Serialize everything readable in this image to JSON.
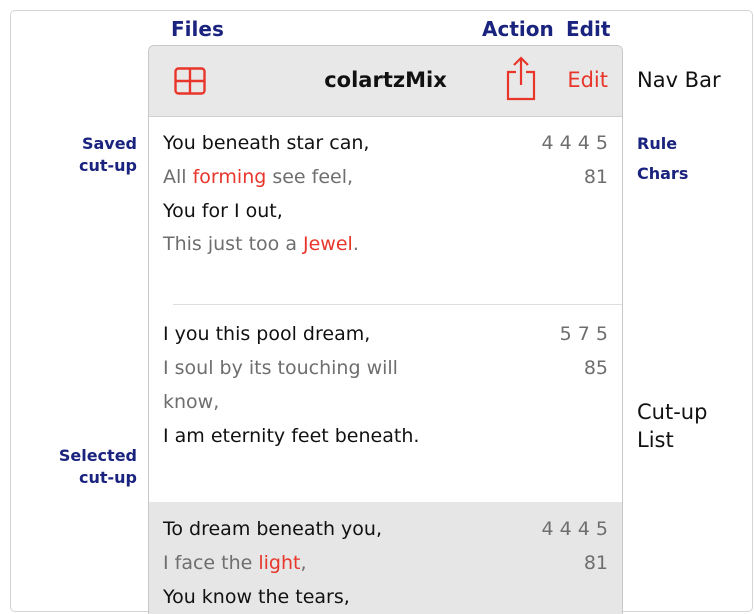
{
  "annotations": {
    "files": "Files",
    "action": "Action",
    "edit": "Edit",
    "nav_bar": "Nav Bar",
    "saved_line1": "Saved",
    "saved_line2": "cut-up",
    "rule": "Rule",
    "chars": "Chars",
    "cutup_list_line1": "Cut-up",
    "cutup_list_line2": "List",
    "selected_line1": "Selected",
    "selected_line2": "cut-up"
  },
  "navbar": {
    "title": "colartzMix",
    "edit_label": "Edit",
    "files_icon": "grid-icon",
    "action_icon": "share-icon"
  },
  "cutups": [
    {
      "lines": [
        {
          "pre": "You beneath star can,",
          "hl": "",
          "post": ""
        },
        {
          "pre": "All ",
          "hl": "forming",
          "post": " see feel,"
        },
        {
          "pre": "You for I out,",
          "hl": "",
          "post": ""
        },
        {
          "pre": "This just too a ",
          "hl": "Jewel",
          "post": "."
        }
      ],
      "rule": "4 4 4 5",
      "chars": "81",
      "selected": false
    },
    {
      "lines": [
        {
          "pre": "I you this pool dream,",
          "hl": "",
          "post": ""
        },
        {
          "pre": "I soul by its touching will",
          "hl": "",
          "post": ""
        },
        {
          "pre": "know,",
          "hl": "",
          "post": ""
        },
        {
          "pre": "I am eternity feet beneath.",
          "hl": "",
          "post": ""
        }
      ],
      "rule": "5 7 5",
      "chars": "85",
      "selected": false
    },
    {
      "lines": [
        {
          "pre": "To dream beneath you,",
          "hl": "",
          "post": ""
        },
        {
          "pre": "I face the ",
          "hl": "light",
          "post": ","
        },
        {
          "pre": "You know the tears,",
          "hl": "",
          "post": ""
        }
      ],
      "rule": "4 4 4 5",
      "chars": "81",
      "selected": true
    }
  ],
  "colors": {
    "accent_red": "#e8362b",
    "annotation_blue": "#1a237e",
    "navbar_bg": "#e8e8e8",
    "selected_bg": "#e6e6e6"
  }
}
